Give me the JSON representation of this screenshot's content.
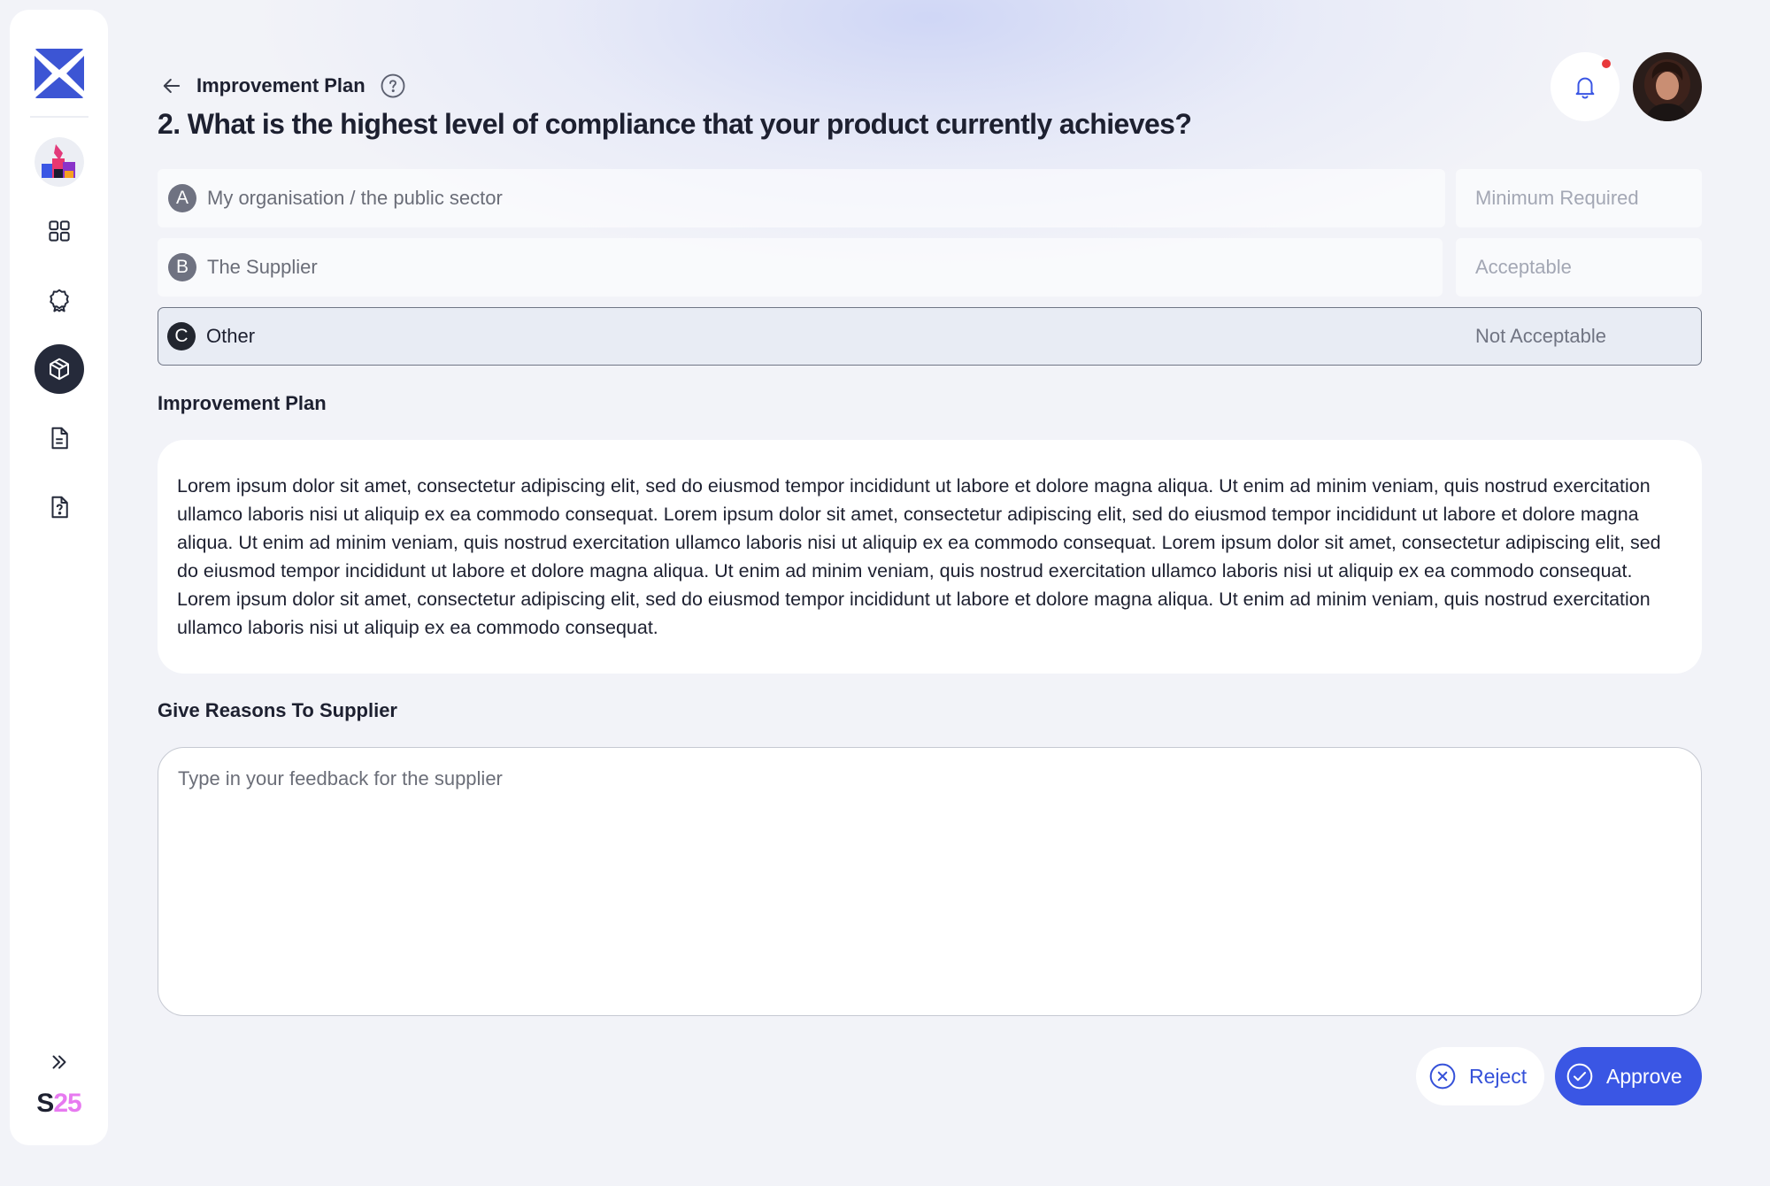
{
  "header": {
    "breadcrumb_title": "Improvement Plan",
    "question": "2. What is the highest level of compliance that your product currently achieves?"
  },
  "options": [
    {
      "letter": "A",
      "label": "My organisation / the public sector",
      "status": "Minimum Required"
    },
    {
      "letter": "B",
      "label": "The Supplier",
      "status": "Acceptable"
    },
    {
      "letter": "C",
      "label": "Other",
      "status": "Not Acceptable",
      "selected": true
    }
  ],
  "improvement_plan": {
    "label": "Improvement Plan",
    "text": "Lorem ipsum dolor sit amet, consectetur adipiscing elit, sed do eiusmod tempor incididunt ut labore et dolore magna aliqua. Ut enim ad minim veniam, quis nostrud exercitation ullamco laboris nisi ut aliquip ex ea commodo consequat. Lorem ipsum dolor sit amet, consectetur adipiscing elit, sed do eiusmod tempor incididunt ut labore et dolore magna aliqua. Ut enim ad minim veniam, quis nostrud exercitation ullamco laboris nisi ut aliquip ex ea commodo consequat. Lorem ipsum dolor sit amet, consectetur adipiscing elit, sed do eiusmod tempor incididunt ut labore et dolore magna aliqua. Ut enim ad minim veniam, quis nostrud exercitation ullamco laboris nisi ut aliquip ex ea commodo consequat. Lorem ipsum dolor sit amet, consectetur adipiscing elit, sed do eiusmod tempor incididunt ut labore et dolore magna aliqua. Ut enim ad minim veniam, quis nostrud exercitation ullamco laboris nisi ut aliquip ex ea commodo consequat."
  },
  "reasons": {
    "label": "Give Reasons To Supplier",
    "placeholder": "Type in your feedback for the supplier",
    "value": ""
  },
  "actions": {
    "reject_label": "Reject",
    "approve_label": "Approve"
  },
  "sidebar": {
    "brand_s": "S",
    "brand_num": "25",
    "items": [
      {
        "icon": "grid-icon"
      },
      {
        "icon": "award-icon"
      },
      {
        "icon": "box-icon",
        "active": true
      },
      {
        "icon": "document-icon"
      },
      {
        "icon": "document-question-icon"
      }
    ]
  },
  "colors": {
    "accent": "#3a56e4",
    "active_nav": "#252a3a",
    "brand_pink": "#e77af0",
    "notification_dot": "#e8383a"
  }
}
